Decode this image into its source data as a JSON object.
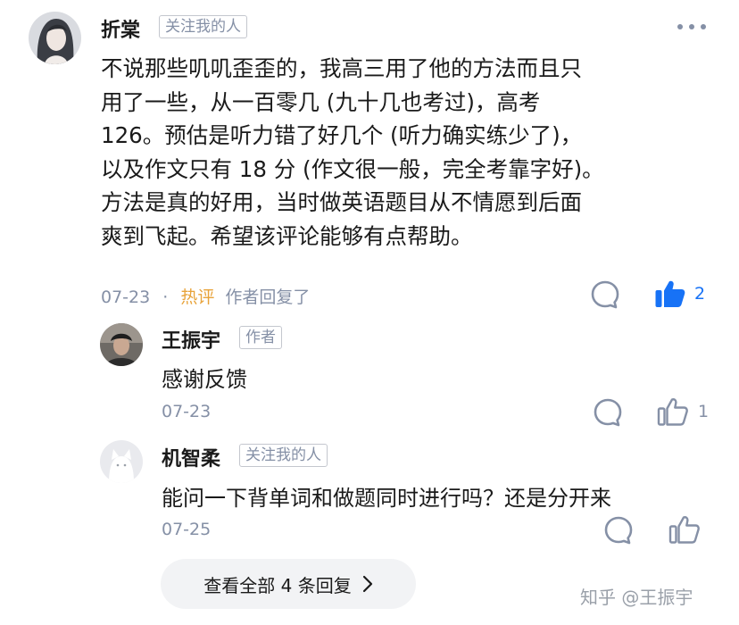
{
  "comment": {
    "author": "折棠",
    "badge": "关注我的人",
    "lines": [
      "不说那些叽叽歪歪的，我高三用了他的方法而且只",
      "用了一些，从一百零几 (九十几也考过)，高考",
      "126。预估是听力错了好几个 (听力确实练少了)，",
      "以及作文只有 18 分 (作文很一般，完全考靠字好)。",
      "方法是真的好用，当时做英语题目从不情愿到后面",
      "爽到飞起。希望该评论能够有点帮助。"
    ],
    "date": "07-23",
    "separator": "·",
    "hot_label": "热评",
    "author_replied": "作者回复了",
    "like_count": "2",
    "liked": true
  },
  "replies": [
    {
      "author": "王振宇",
      "badge": "作者",
      "text": "感谢反馈",
      "date": "07-23",
      "like_count": "1"
    },
    {
      "author": "机智柔",
      "badge": "关注我的人",
      "text": "能问一下背单词和做题同时进行吗？还是分开来",
      "date": "07-25",
      "like_count": ""
    }
  ],
  "view_all_label": "查看全部 4 条回复",
  "watermark": "知乎 @王振宇",
  "colors": {
    "accent": "#1772f6",
    "hot": "#e8a33a",
    "meta": "#8590a6"
  },
  "icons": [
    "more-icon",
    "comment-icon",
    "thumbs-up-icon",
    "chevron-right-icon"
  ]
}
